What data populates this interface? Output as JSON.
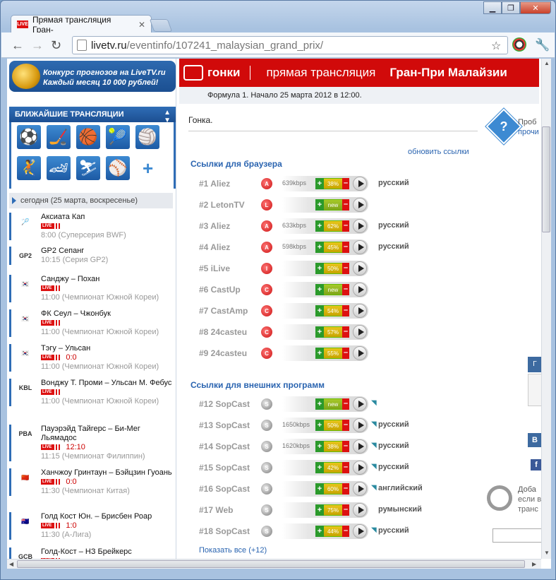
{
  "browser": {
    "tab_title": "Прямая трансляция Гран-",
    "tab_favicon": "LIVE",
    "url_host": "livetv.ru",
    "url_path": "/eventinfo/107241_malaysian_grand_prix/"
  },
  "promo": {
    "line1": "Конкурс прогнозов на LiveTV.ru",
    "line2": "Каждый месяц 10 000 рублей!"
  },
  "sidebar": {
    "header": "БЛИЖАЙШИЕ ТРАНСЛЯЦИИ",
    "today": "сегодня (25 марта, воскресенье)",
    "plus": "+",
    "events": [
      {
        "name": "Аксиата Кап",
        "score": "",
        "time": "8:00 (Суперсерия BWF)"
      },
      {
        "name": "GP2 Сепанг",
        "score": "",
        "time": "10:15 (Серия GP2)",
        "nolive": true
      },
      {
        "name": "Санджу – Похан",
        "score": "",
        "time": "11:00 (Чемпионат Южной Кореи)"
      },
      {
        "name": "ФК Сеул – Чжонбук",
        "score": "",
        "time": "11:00 (Чемпионат Южной Кореи)"
      },
      {
        "name": "Тэгу – Ульсан",
        "score": "0:0",
        "time": "11:00 (Чемпионат Южной Кореи)"
      },
      {
        "name": "Вонджу Т. Проми – Ульсан М. Фебус",
        "score": "",
        "time": "11:00 (Чемпионат Южной Кореи)"
      },
      {
        "name": "Пауэрэйд Тайгерс – Би-Мег Льямадос",
        "score": "12:10",
        "time": "11:15 (Чемпионат Филиппин)"
      },
      {
        "name": "Ханчжоу Гринтаун – Бэйцзин Гуоань",
        "score": "0:0",
        "time": "11:30 (Чемпионат Китая)"
      },
      {
        "name": "Голд Кост Юн. – Брисбен Роар",
        "score": "1:0",
        "time": "11:30 (А-Лига)"
      },
      {
        "name": "Голд-Кост – НЗ Брейкерс",
        "score": "",
        "time": ""
      }
    ],
    "live_label": "LIVE"
  },
  "header": {
    "sport": "гонки",
    "type": "прямая трансляция",
    "event": "Гран-При Малайзии",
    "subline": "Формула 1. Начало 25 марта 2012 в 12:00."
  },
  "main": {
    "race_label": "Гонка.",
    "refresh": "обновить ссылки",
    "browser_links_title": "Ссылки для браузера",
    "external_title": "Ссылки для внешних программ",
    "show_all": "Показать все (+12)",
    "browser_links": [
      {
        "name": "#1 Aliez",
        "badge": "A",
        "kbps": "639kbps",
        "rating": "38%",
        "lang": "русский"
      },
      {
        "name": "#2 LetonTV",
        "badge": "L",
        "kbps": "",
        "rating": "new",
        "lang": ""
      },
      {
        "name": "#3 Aliez",
        "badge": "A",
        "kbps": "633kbps",
        "rating": "62%",
        "lang": "русский"
      },
      {
        "name": "#4 Aliez",
        "badge": "A",
        "kbps": "598kbps",
        "rating": "45%",
        "lang": "русский"
      },
      {
        "name": "#5 iLive",
        "badge": "I",
        "kbps": "",
        "rating": "50%",
        "lang": ""
      },
      {
        "name": "#6 CastUp",
        "badge": "C",
        "kbps": "",
        "rating": "new",
        "lang": ""
      },
      {
        "name": "#7 CastAmp",
        "badge": "C",
        "kbps": "",
        "rating": "54%",
        "lang": ""
      },
      {
        "name": "#8 24casteu",
        "badge": "C",
        "kbps": "",
        "rating": "57%",
        "lang": ""
      },
      {
        "name": "#9 24casteu",
        "badge": "C",
        "kbps": "",
        "rating": "55%",
        "lang": ""
      }
    ],
    "external_links": [
      {
        "name": "#12 SopCast",
        "kbps": "",
        "rating": "new",
        "lang": "",
        "ext": true
      },
      {
        "name": "#13 SopCast",
        "kbps": "1650kbps",
        "rating": "50%",
        "lang": "русский",
        "ext": true
      },
      {
        "name": "#14 SopCast",
        "kbps": "1620kbps",
        "rating": "38%",
        "lang": "русский",
        "ext": true
      },
      {
        "name": "#15 SopCast",
        "kbps": "",
        "rating": "42%",
        "lang": "русский",
        "ext": true
      },
      {
        "name": "#16 SopCast",
        "kbps": "",
        "rating": "60%",
        "lang": "английский",
        "ext": true
      },
      {
        "name": "#17 Web",
        "kbps": "",
        "rating": "75%",
        "lang": "румынский",
        "ext": false
      },
      {
        "name": "#18 SopCast",
        "kbps": "",
        "rating": "44%",
        "lang": "русский",
        "ext": true
      }
    ],
    "plus_sign": "+",
    "minus_sign": "–"
  },
  "right": {
    "help1": "Проб",
    "help2": "прочи",
    "add1": "Доба",
    "add2": "если в",
    "add3": "транс",
    "b1": "Г",
    "b2": "В",
    "b3": "f"
  }
}
